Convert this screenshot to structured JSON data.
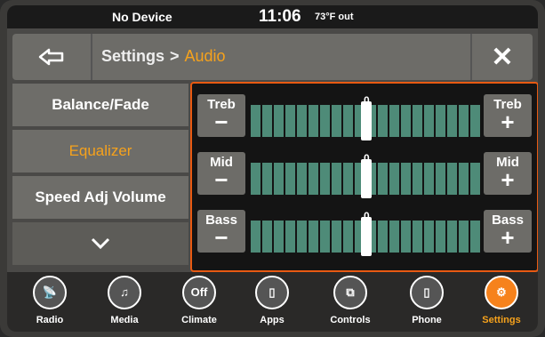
{
  "status": {
    "device": "No Device",
    "time": "11:06",
    "temp": "73°F out"
  },
  "header": {
    "settings": "Settings",
    "separator": ">",
    "current": "Audio",
    "close": "✕"
  },
  "menu": [
    "Balance/Fade",
    "Equalizer",
    "Speed Adj Volume"
  ],
  "menu_active": 1,
  "equalizer": {
    "treb": {
      "label": "Treb",
      "value": "0"
    },
    "mid": {
      "label": "Mid",
      "value": "0"
    },
    "bass": {
      "label": "Bass",
      "value": "0"
    },
    "minus": "−",
    "plus": "+"
  },
  "dock": [
    {
      "label": "Radio",
      "icon": "radio-icon",
      "glyph": "📡"
    },
    {
      "label": "Media",
      "icon": "media-icon",
      "glyph": "♫"
    },
    {
      "label": "Climate",
      "icon": "climate-icon",
      "glyph": "Off"
    },
    {
      "label": "Apps",
      "icon": "apps-icon",
      "glyph": "▯"
    },
    {
      "label": "Controls",
      "icon": "controls-icon",
      "glyph": "⧉"
    },
    {
      "label": "Phone",
      "icon": "phone-icon",
      "glyph": "▯"
    },
    {
      "label": "Settings",
      "icon": "settings-icon",
      "glyph": "⚙"
    }
  ],
  "colors": {
    "accent": "#f6a21c",
    "segment": "#4e8b78",
    "active_dock": "#f6821c"
  }
}
